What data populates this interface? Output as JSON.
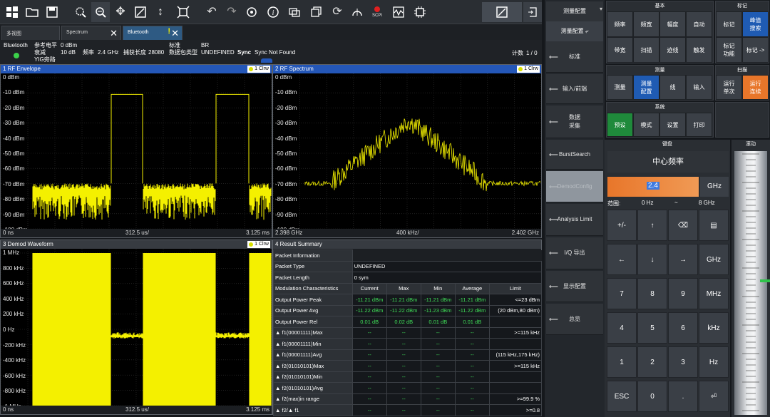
{
  "toolbar": {
    "icons": [
      "windows-icon",
      "open-folder-icon",
      "save-icon",
      "zoom-select-icon",
      "zoom-in-icon",
      "pan-icon",
      "zoom-area-icon",
      "vertical-zoom-icon",
      "auto-zoom-icon",
      "undo-icon",
      "redo-icon",
      "preset-icon",
      "info-icon",
      "screenshot-icon",
      "window-icon",
      "refresh-icon",
      "transducer-icon",
      "scpi-icon",
      "waveform-icon",
      "settings-chip-icon",
      "display-fit-icon",
      "exit-icon"
    ],
    "scpi_label": "SCPI"
  },
  "tabs": [
    {
      "label": "多视图",
      "closable": false
    },
    {
      "label": "Spectrum",
      "closable": true
    },
    {
      "label": "Bluetooth",
      "closable": true,
      "warning": "!"
    }
  ],
  "info": {
    "app": "Bluetooth",
    "ref_level_label": "参考电平",
    "ref_level": "0 dBm",
    "atten_label": "衰减",
    "atten": "10 dB",
    "freq_label": "频率",
    "freq": "2.4 GHz",
    "capture_label": "捕获长度",
    "capture": "28080",
    "yig_label": "YIG旁路",
    "standard_label": "标准",
    "standard": "BR",
    "packet_type_label": "数据包类型",
    "packet_type": "UNDEFINED",
    "sync_label": "Sync",
    "sync_value": "Sync Not Found",
    "count_label": "计数",
    "count_value": "1 / 0"
  },
  "panels": {
    "p1": {
      "title": "1 RF Envelope",
      "trace": "1 Clrw",
      "yticks": [
        "0 dBm",
        "-10 dBm",
        "-20 dBm",
        "-30 dBm",
        "-40 dBm",
        "-50 dBm",
        "-60 dBm",
        "-70 dBm",
        "-80 dBm",
        "-90 dBm",
        "-100 dBm"
      ],
      "xstart": "0 ns",
      "xdiv": "312.5 us/",
      "xend": "3.125 ms"
    },
    "p2": {
      "title": "2 RF Spectrum",
      "trace": "1 Clrw",
      "yticks": [
        "0 dBm",
        "-10 dBm",
        "-20 dBm",
        "-30 dBm",
        "-40 dBm",
        "-50 dBm",
        "-60 dBm",
        "-70 dBm",
        "-80 dBm",
        "-90 dBm",
        "-100 dBm"
      ],
      "xstart": "2.398 GHz",
      "xdiv": "400 kHz/",
      "xend": "2.402 GHz"
    },
    "p3": {
      "title": "3 Demod Waveform",
      "trace": "1 Clrw",
      "yticks": [
        "1 MHz",
        "800 kHz",
        "600 kHz",
        "400 kHz",
        "200 kHz",
        "0 Hz",
        "-200 kHz",
        "-400 kHz",
        "-600 kHz",
        "-800 kHz",
        "-1 MHz"
      ],
      "xstart": "0 ns",
      "xdiv": "312.5 us/",
      "xend": "3.125 ms"
    },
    "p4": {
      "title": "4 Result Summary"
    }
  },
  "summary": {
    "packet_info_label": "Packet Information",
    "packet_type_label": "Packet Type",
    "packet_type_value": "UNDEFINED",
    "packet_length_label": "Packet Length",
    "packet_length_value": "0 sym",
    "headers": [
      "Modulation Characteristics",
      "Current",
      "Max",
      "Min",
      "Average",
      "Limit"
    ],
    "rows": [
      [
        "Output Power Peak",
        "-11.21 dBm",
        "-11.21 dBm",
        "-11.21 dBm",
        "-11.21 dBm",
        "<=23 dBm"
      ],
      [
        "Output Power Avg",
        "-11.22 dBm",
        "-11.22 dBm",
        "-11.23 dBm",
        "-11.22 dBm",
        "(20 dBm,80 dBm)"
      ],
      [
        "Output Power Rel",
        "0.01 dB",
        "0.02 dB",
        "0.01 dB",
        "0.01 dB",
        ""
      ],
      [
        "▲ f1(00001111)Max",
        "--",
        "--",
        "--",
        "--",
        ">=115 kHz"
      ],
      [
        "▲ f1(00001111)Min",
        "--",
        "--",
        "--",
        "--",
        ""
      ],
      [
        "▲ f1(00001111)Avg",
        "--",
        "--",
        "--",
        "--",
        "(115 kHz,175 kHz)"
      ],
      [
        "▲ f2(01010101)Max",
        "--",
        "--",
        "--",
        "--",
        ">=115 kHz"
      ],
      [
        "▲ f2(01010101)Min",
        "--",
        "--",
        "--",
        "--",
        ""
      ],
      [
        "▲ f2(01010101)Avg",
        "--",
        "--",
        "--",
        "--",
        ""
      ],
      [
        "▲ f2(max)in range",
        "--",
        "--",
        "--",
        "--",
        ">=99.9 %"
      ],
      [
        "▲ f2/▲ f1",
        "--",
        "--",
        "--",
        "--",
        ">=0.8"
      ]
    ]
  },
  "side": {
    "header": "测量配置",
    "sub": "测量配置",
    "buttons": [
      "标准",
      "输入/前端",
      "数据\n采集",
      "BurstSearch",
      "DemodConfig",
      "Analysis Limit",
      "I/Q 导出",
      "显示配置",
      "总览"
    ]
  },
  "groups": {
    "basic": {
      "title": "基本",
      "buttons": [
        "频率",
        "频宽",
        "幅度",
        "自动",
        "带宽",
        "扫描",
        "迹线",
        "触发"
      ]
    },
    "marker": {
      "title": "标记",
      "buttons": [
        "标记",
        "峰值\n搜索",
        "标记\n功能",
        "标记 ->"
      ]
    },
    "measure": {
      "title": "测量",
      "buttons": [
        "测量",
        "测量\n配置",
        "线",
        "输入"
      ]
    },
    "sweep": {
      "title": "扫描",
      "buttons": [
        "运行\n单次",
        "运行\n连续"
      ]
    },
    "system": {
      "title": "系统",
      "buttons": [
        "预设",
        "模式",
        "设置",
        "打印"
      ]
    }
  },
  "keypad": {
    "title": "键盘",
    "scroll_title": "滚动",
    "param": "中心频率",
    "value": "2.4",
    "unit": "GHz",
    "range_label": "范围:",
    "range_min": "0 Hz",
    "range_sep": "~",
    "range_max": "8 GHz",
    "keys": [
      "+/-",
      "↑",
      "⌫",
      "▤",
      "←",
      "↓",
      "→",
      "GHz",
      "7",
      "8",
      "9",
      "MHz",
      "4",
      "5",
      "6",
      "kHz",
      "1",
      "2",
      "3",
      "Hz",
      "ESC",
      "0",
      ".",
      "⏎"
    ]
  },
  "colors": {
    "trace": "#f4f000",
    "header_blue": "#2457b8",
    "accent_orange": "#e8762a",
    "accent_green": "#1f8a3b"
  }
}
